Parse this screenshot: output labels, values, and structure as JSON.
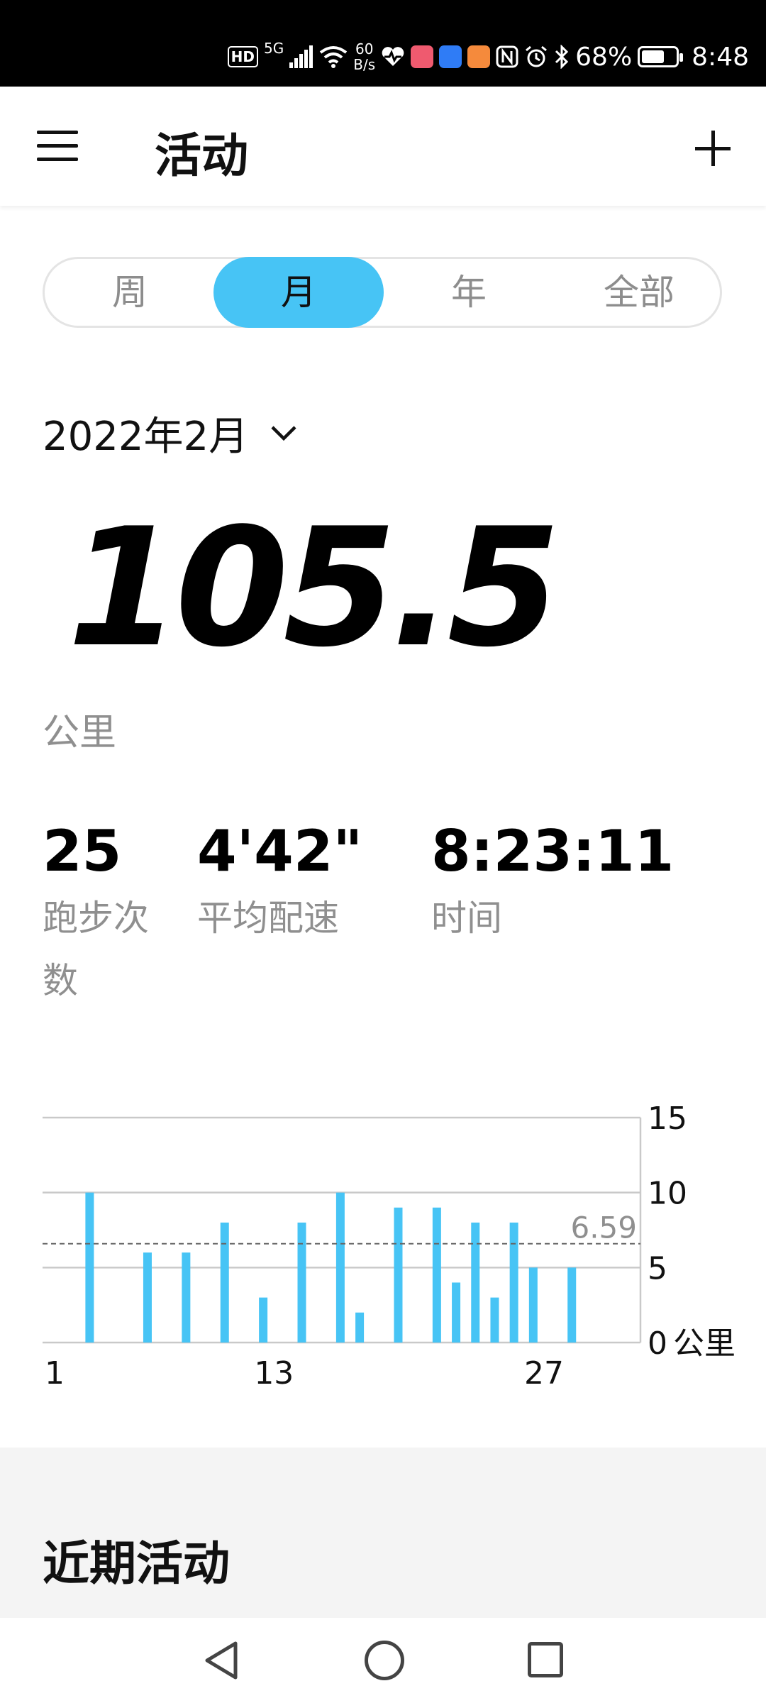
{
  "status_bar": {
    "hd": "HD",
    "network": "5G",
    "speed_top": "60",
    "speed_bottom": "B/s",
    "battery": "68%",
    "battery_level": 0.68,
    "time": "8:48",
    "icons": [
      "signal-icon",
      "wifi-icon",
      "heart-rate-icon",
      "book-app-icon",
      "bulb-app-icon",
      "health-app-icon",
      "nfc-icon",
      "alarm-icon",
      "bluetooth-icon",
      "battery-icon"
    ]
  },
  "app_bar": {
    "title": "活动",
    "menu_icon": "hamburger-menu-icon",
    "add_icon": "plus-icon"
  },
  "segments": {
    "items": [
      "周",
      "月",
      "年",
      "全部"
    ],
    "active": "月"
  },
  "month": {
    "label": "2022年2月",
    "icon": "chevron-down-icon"
  },
  "summary": {
    "distance": "105.5",
    "distance_unit": "公里",
    "runs_value": "25",
    "runs_label_line1": "跑步次",
    "runs_label_line2": "数",
    "pace_value": "4'42\"",
    "pace_label": "平均配速",
    "time_value": "8:23:11",
    "time_label": "时间"
  },
  "chart_data": {
    "type": "bar",
    "x": [
      3,
      6,
      8,
      10,
      12,
      14,
      16,
      17,
      19,
      21,
      22,
      23,
      24,
      25,
      26,
      28
    ],
    "values": [
      10,
      6,
      6,
      8,
      3,
      8,
      10,
      2,
      9,
      9,
      4,
      8,
      3,
      8,
      5,
      5
    ],
    "x_ticks": [
      "1",
      "13",
      "27"
    ],
    "x_tick_values": [
      1,
      13,
      27
    ],
    "y_ticks": [
      "15",
      "10",
      "5",
      "0"
    ],
    "y_unit": "公里",
    "ylim": [
      0,
      15
    ],
    "xlim": [
      1,
      32
    ],
    "average": 6.59,
    "average_label": "6.59",
    "bar_color": "#47c4f5",
    "grid": true
  },
  "recent": {
    "title": "近期活动"
  },
  "nav_bar": {
    "icons": [
      "back-icon",
      "home-icon",
      "recents-icon"
    ]
  }
}
